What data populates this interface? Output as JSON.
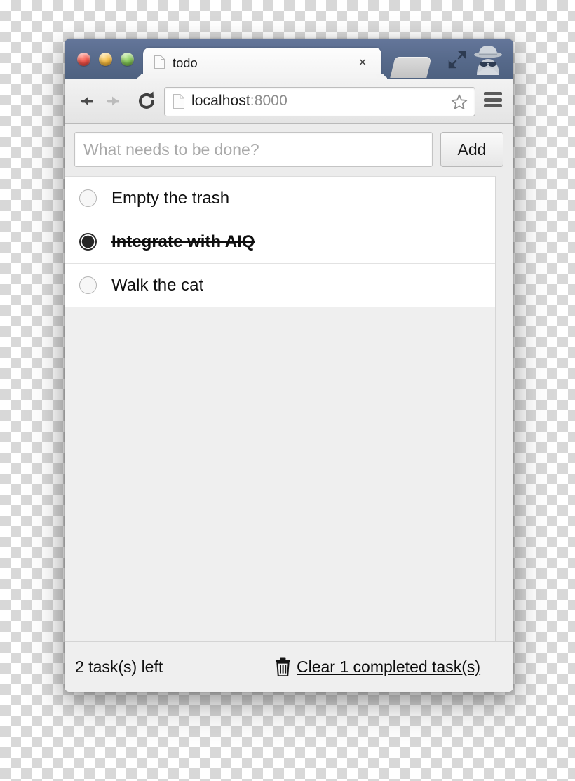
{
  "browser": {
    "window_controls": [
      {
        "name": "close",
        "color": "#f0544a"
      },
      {
        "name": "minimize",
        "color": "#f3ba43"
      },
      {
        "name": "zoom",
        "color": "#85c65a"
      }
    ],
    "tab": {
      "title": "todo",
      "favicon": "document-icon",
      "close_label": "×"
    },
    "new_tab_icon": "new-tab-icon",
    "expand_icon": "fullscreen-expand-icon",
    "incognito_icon": "incognito-spy-icon",
    "toolbar": {
      "back_icon": "back-arrow-icon",
      "forward_icon": "forward-arrow-icon",
      "reload_icon": "reload-icon",
      "bookmark_icon": "star-icon",
      "menu_icon": "hamburger-menu-icon",
      "url_favicon": "document-icon",
      "url_host": "localhost",
      "url_port": ":8000"
    }
  },
  "app": {
    "input": {
      "placeholder": "What needs to be done?",
      "value": ""
    },
    "add_button": "Add",
    "todos": [
      {
        "label": "Empty the trash",
        "done": false
      },
      {
        "label": "Integrate with AIQ",
        "done": true
      },
      {
        "label": "Walk the cat",
        "done": false
      }
    ],
    "footer": {
      "tasks_left": "2 task(s) left",
      "clear_icon": "trash-icon",
      "clear_label": "Clear 1 completed task(s)"
    }
  }
}
